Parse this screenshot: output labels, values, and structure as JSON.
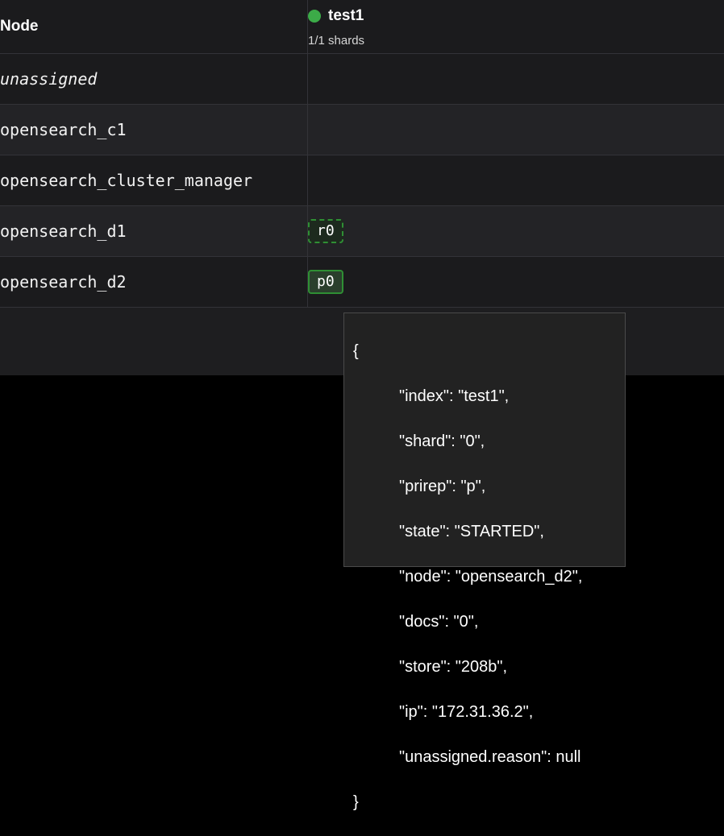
{
  "table": {
    "header": {
      "node_label": "Node",
      "index_name": "test1",
      "index_health_color": "#3cab48",
      "index_shards": "1/1 shards"
    },
    "rows": [
      {
        "node": "unassigned",
        "shard": ""
      },
      {
        "node": "opensearch_c1",
        "shard": ""
      },
      {
        "node": "opensearch_cluster_manager",
        "shard": ""
      },
      {
        "node": "opensearch_d1",
        "shard": "r0"
      },
      {
        "node": "opensearch_d2",
        "shard": "p0"
      }
    ]
  },
  "tooltip": {
    "open_brace": "{",
    "close_brace": "}",
    "lines": [
      "\"index\": \"test1\",",
      "\"shard\": \"0\",",
      "\"prirep\": \"p\",",
      "\"state\": \"STARTED\",",
      "\"node\": \"opensearch_d2\",",
      "\"docs\": \"0\",",
      "\"store\": \"208b\",",
      "\"ip\": \"172.31.36.2\",",
      "\"unassigned.reason\": null"
    ]
  }
}
